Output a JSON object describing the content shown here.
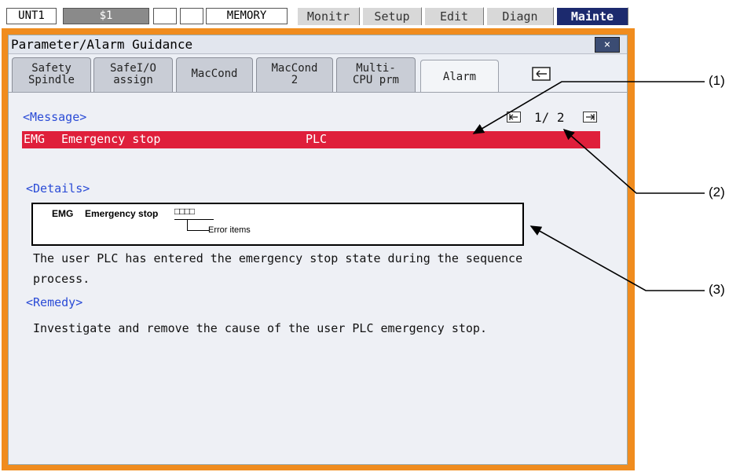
{
  "status_bar": {
    "unit": "UNT1",
    "system": "$1",
    "mode": "MEMORY"
  },
  "menu_tabs": [
    {
      "label": "Monitr",
      "active": false
    },
    {
      "label": "Setup",
      "active": false
    },
    {
      "label": "Edit",
      "active": false
    },
    {
      "label": "Diagn",
      "active": false
    },
    {
      "label": "Mainte",
      "active": true
    }
  ],
  "window": {
    "title": "Parameter/Alarm Guidance",
    "close_label": "×"
  },
  "tabs": [
    {
      "line1": "Safety",
      "line2": "Spindle",
      "active": false
    },
    {
      "line1": "SafeI/O",
      "line2": "assign",
      "active": false
    },
    {
      "line1": "MacCond",
      "line2": "",
      "active": false
    },
    {
      "line1": "MacCond",
      "line2": "2",
      "active": false
    },
    {
      "line1": "Multi-",
      "line2": "CPU prm",
      "active": false
    },
    {
      "line1": "Alarm",
      "line2": "",
      "active": true
    }
  ],
  "message": {
    "heading": "<Message>",
    "code": "EMG",
    "text": "Emergency stop",
    "source": "PLC",
    "page": "1/ 2",
    "bar_color": "#df1f3b"
  },
  "details": {
    "heading": "<Details>",
    "diagram_code": "EMG",
    "diagram_text": "Emergency stop",
    "diagram_boxes": "□□□□",
    "diagram_note": "Error items",
    "line1": "The user PLC has entered the emergency stop state during the sequence",
    "line2": "process."
  },
  "remedy": {
    "heading": "<Remedy>",
    "text": "Investigate and remove the cause of the user PLC emergency stop."
  },
  "callouts": {
    "c1": "(1)",
    "c2": "(2)",
    "c3": "(3)"
  },
  "colors": {
    "window_frame": "#f08c1e",
    "active_menu_tab": "#1c2a6e",
    "section_heading": "#2a4bd6"
  }
}
